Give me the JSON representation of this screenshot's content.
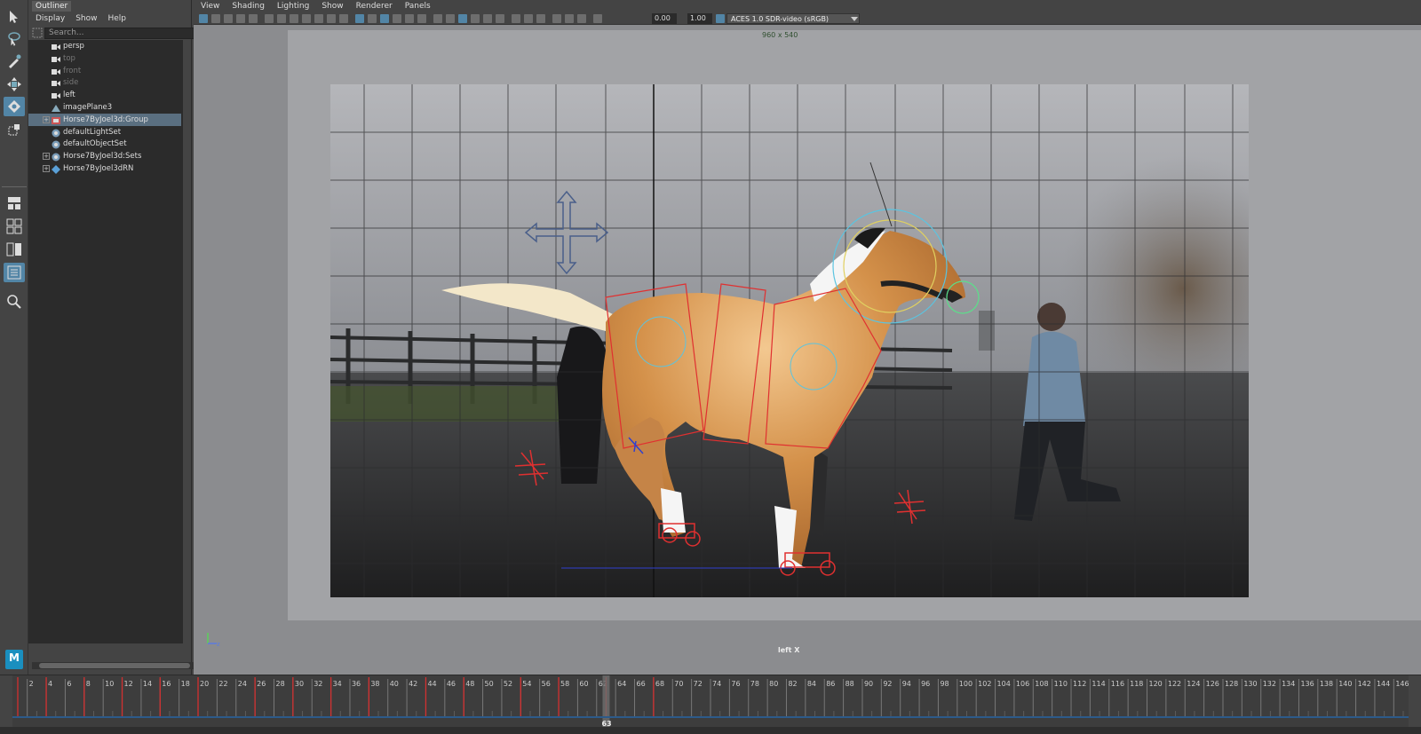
{
  "outliner": {
    "tab_label": "Outliner",
    "menu": [
      "Display",
      "Show",
      "Help"
    ],
    "search_placeholder": "Search...",
    "items": [
      {
        "label": "persp",
        "icon": "camera-icon",
        "dim": false,
        "expandable": false,
        "selected": false
      },
      {
        "label": "top",
        "icon": "camera-icon",
        "dim": true,
        "expandable": false,
        "selected": false
      },
      {
        "label": "front",
        "icon": "camera-icon",
        "dim": true,
        "expandable": false,
        "selected": false
      },
      {
        "label": "side",
        "icon": "camera-icon",
        "dim": true,
        "expandable": false,
        "selected": false
      },
      {
        "label": "left",
        "icon": "camera-icon",
        "dim": false,
        "expandable": false,
        "selected": false
      },
      {
        "label": "imagePlane3",
        "icon": "image-plane-icon",
        "dim": false,
        "expandable": false,
        "selected": false
      },
      {
        "label": "Horse7ByJoel3d:Group",
        "icon": "group-icon",
        "dim": false,
        "expandable": true,
        "selected": true
      },
      {
        "label": "defaultLightSet",
        "icon": "set-icon",
        "dim": false,
        "expandable": false,
        "selected": false
      },
      {
        "label": "defaultObjectSet",
        "icon": "set-icon",
        "dim": false,
        "expandable": false,
        "selected": false
      },
      {
        "label": "Horse7ByJoel3d:Sets",
        "icon": "set-icon",
        "dim": false,
        "expandable": true,
        "selected": false
      },
      {
        "label": "Horse7ByJoel3dRN",
        "icon": "reference-icon",
        "dim": false,
        "expandable": true,
        "selected": false
      }
    ]
  },
  "viewport": {
    "menu": [
      "View",
      "Shading",
      "Lighting",
      "Show",
      "Renderer",
      "Panels"
    ],
    "field_exposure": "0.00",
    "field_gamma": "1.00",
    "colorspace": "ACES 1.0 SDR-video (sRGB)",
    "resolution": "960 x 540",
    "view_name": "left X"
  },
  "timeline": {
    "ticks": [
      "2",
      "4",
      "6",
      "8",
      "10",
      "12",
      "14",
      "16",
      "18",
      "20",
      "22",
      "24",
      "26",
      "28",
      "30",
      "32",
      "34",
      "36",
      "38",
      "40",
      "42",
      "44",
      "46",
      "48",
      "50",
      "52",
      "54",
      "56",
      "58",
      "60",
      "62",
      "64",
      "66",
      "68",
      "70",
      "72",
      "74",
      "76",
      "78",
      "80",
      "82",
      "84",
      "86",
      "88",
      "90",
      "92",
      "94",
      "96",
      "98",
      "100",
      "102",
      "104",
      "106",
      "108",
      "110",
      "112",
      "114",
      "116",
      "118",
      "120",
      "122",
      "124",
      "126",
      "128",
      "130",
      "132",
      "134",
      "136",
      "138",
      "140",
      "142",
      "144",
      "146"
    ],
    "keyframes": [
      1,
      4,
      8,
      12,
      16,
      20,
      26,
      30,
      34,
      38,
      44,
      48,
      54,
      58,
      63,
      68
    ],
    "current_frame": "63",
    "start": 1,
    "end": 147
  },
  "toolbox": {
    "tools": [
      "select-tool-icon",
      "lasso-tool-icon",
      "paint-select-icon",
      "move-tool-icon",
      "rotate-tool-icon",
      "scale-tool-icon"
    ],
    "active_tool": "rotate-tool-icon"
  },
  "logo": "M"
}
